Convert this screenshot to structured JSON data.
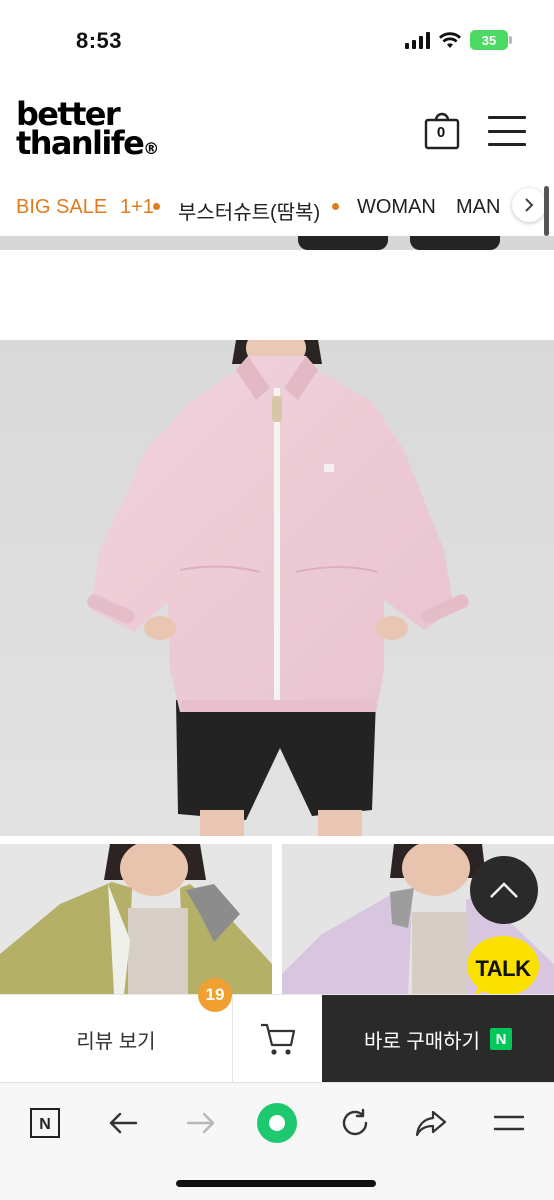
{
  "status_bar": {
    "time": "8:53",
    "battery": "35"
  },
  "header": {
    "logo_line1": "better",
    "logo_line2": "thanlife",
    "logo_mark": "®",
    "cart_count": "0",
    "cart_icon": "shopping-bag-icon",
    "menu_icon": "hamburger-menu-icon"
  },
  "categories": [
    {
      "label": "BIG SALE",
      "highlight": true
    },
    {
      "label": "1+1",
      "highlight": true
    },
    {
      "label": "부스터슈트(땀복)",
      "highlight": false
    },
    {
      "label": "WOMAN",
      "highlight": false
    },
    {
      "label": "MAN",
      "highlight": false
    }
  ],
  "colors": {
    "accent": "#e07b20",
    "badge": "#f0a030",
    "buy_button": "#2a2a2a",
    "naver_green": "#03c75a",
    "kakao_yellow": "#fae100"
  },
  "products": {
    "main_photo": "model-pink-jacket-photo",
    "thumb_left": "model-olive-jacket-photo",
    "thumb_right": "model-lavender-jacket-photo"
  },
  "floating": {
    "talk_label": "TALK",
    "scroll_top_icon": "chevron-up-icon"
  },
  "action_bar": {
    "review_label": "리뷰 보기",
    "review_count": "19",
    "buy_label": "바로 구매하기",
    "npay_mark": "N"
  },
  "browser": {
    "naver_label": "N",
    "icons": [
      "naver-home-icon",
      "back-arrow-icon",
      "forward-arrow-icon",
      "green-dot-icon",
      "reload-icon",
      "share-icon",
      "menu-icon"
    ]
  }
}
